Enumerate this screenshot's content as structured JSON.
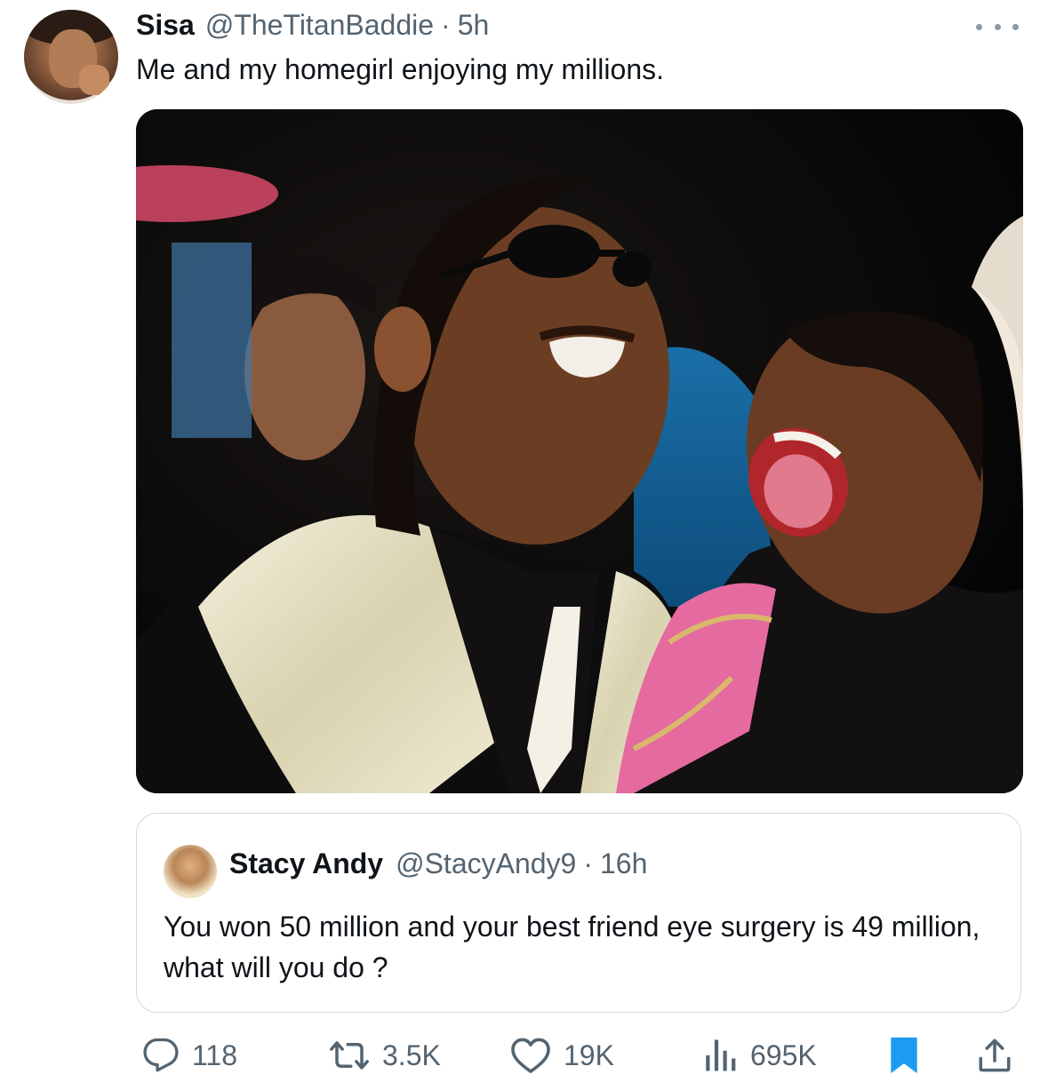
{
  "post": {
    "author_name": "Sisa",
    "author_handle": "@TheTitanBaddie",
    "separator": "·",
    "time": "5h",
    "text": "Me and my homegirl enjoying my millions."
  },
  "quoted": {
    "author_name": "Stacy Andy",
    "author_handle": "@StacyAndy9",
    "separator": "·",
    "time": "16h",
    "text": "You won 50 million and your best friend eye surgery is 49 million, what will you do ?"
  },
  "actions": {
    "replies": "118",
    "reposts": "3.5K",
    "likes": "19K",
    "views": "695K"
  },
  "colors": {
    "text": "#0f1419",
    "secondary": "#536471",
    "bookmark_active": "#1d9bf0",
    "border": "#cfd9de"
  },
  "icons": [
    "more-icon",
    "reply-icon",
    "repost-icon",
    "like-icon",
    "views-icon",
    "bookmark-icon",
    "share-icon"
  ]
}
